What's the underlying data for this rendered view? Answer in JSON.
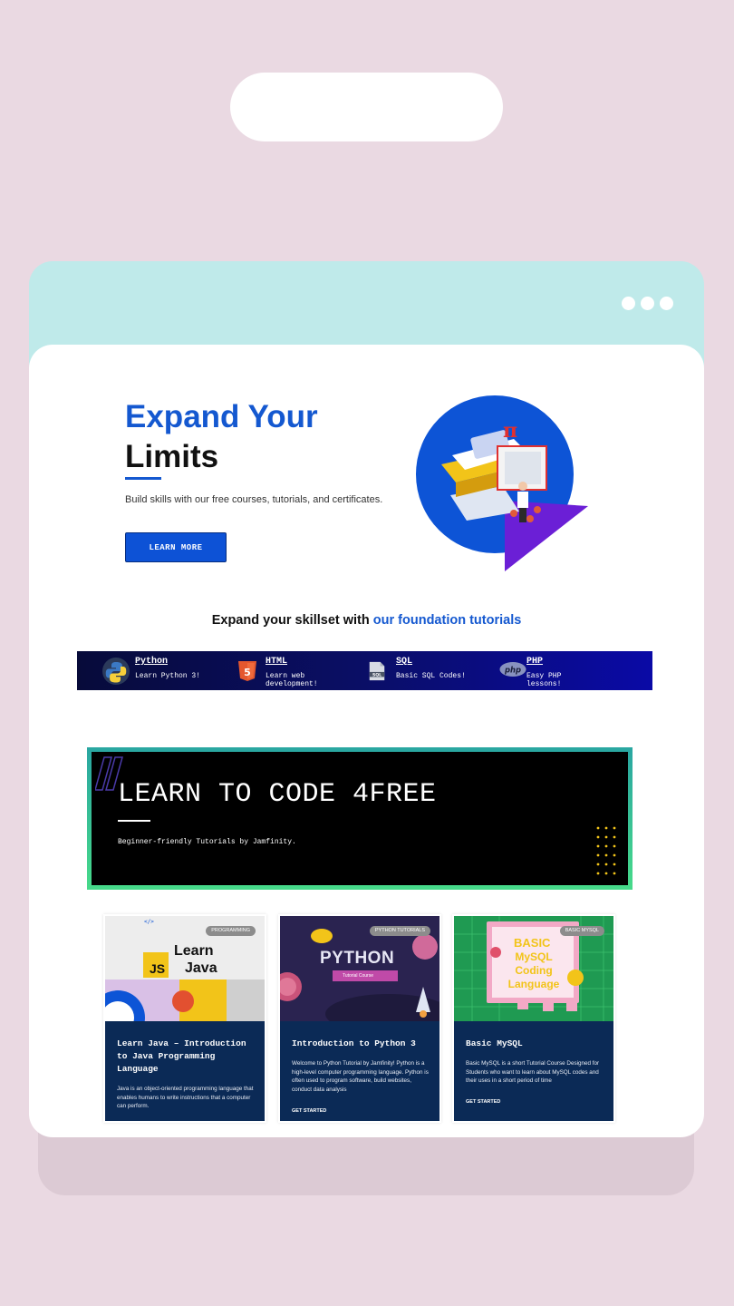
{
  "hero": {
    "title_line1": "Expand Your",
    "title_line2": "Limits",
    "subtitle": "Build skills with our free courses, tutorials, and certificates.",
    "cta_label": "LEARN MORE"
  },
  "skills": {
    "heading_prefix": "Expand your skillset with ",
    "heading_highlight": "our foundation tutorials",
    "items": [
      {
        "name": "Python",
        "desc": "Learn Python 3!",
        "icon": "python-icon"
      },
      {
        "name": "HTML",
        "desc": "Learn web development!",
        "icon": "html5-icon"
      },
      {
        "name": "SQL",
        "desc": "Basic SQL Codes!",
        "icon": "sql-icon"
      },
      {
        "name": "PHP",
        "desc": "Easy PHP lessons!",
        "icon": "php-icon"
      }
    ]
  },
  "banner": {
    "title": "LEARN TO CODE 4FREE",
    "subtitle": "Beginner-friendly Tutorials by Jamfinity."
  },
  "cards": [
    {
      "tag": "PROGRAMMING",
      "thumb_text1": "Learn",
      "thumb_text2": "Java",
      "thumb_badge": "JS",
      "title": "Learn Java – Introduction to Java Programming Language",
      "desc": "Java is an object-oriented programming language that enables humans to write instructions that a computer can perform.",
      "cta": ""
    },
    {
      "tag": "PYTHON TUTORIALS",
      "thumb_text1": "PYTHON",
      "thumb_text2": "Tutorial Course",
      "title": "Introduction to Python 3",
      "desc": "Welcome to Python Tutorial by Jamfinity! Python is a high-level computer programming language. Python is often used to program software, build websites, conduct data analysis",
      "cta": "GET STARTED"
    },
    {
      "tag": "BASIC MYSQL",
      "thumb_text1": "BASIC",
      "thumb_text2": "MySQL Coding Language",
      "title": "Basic MySQL",
      "desc": "Basic MySQL is a short Tutorial Course Designed for Students who want to learn about MySQL codes and their uses in a short period of time",
      "cta": "GET STARTED"
    }
  ],
  "colors": {
    "brand_blue": "#1458d0",
    "card_body": "#0b2a56",
    "page_bg": "#ead9e2",
    "device_top": "#bfeaea"
  }
}
